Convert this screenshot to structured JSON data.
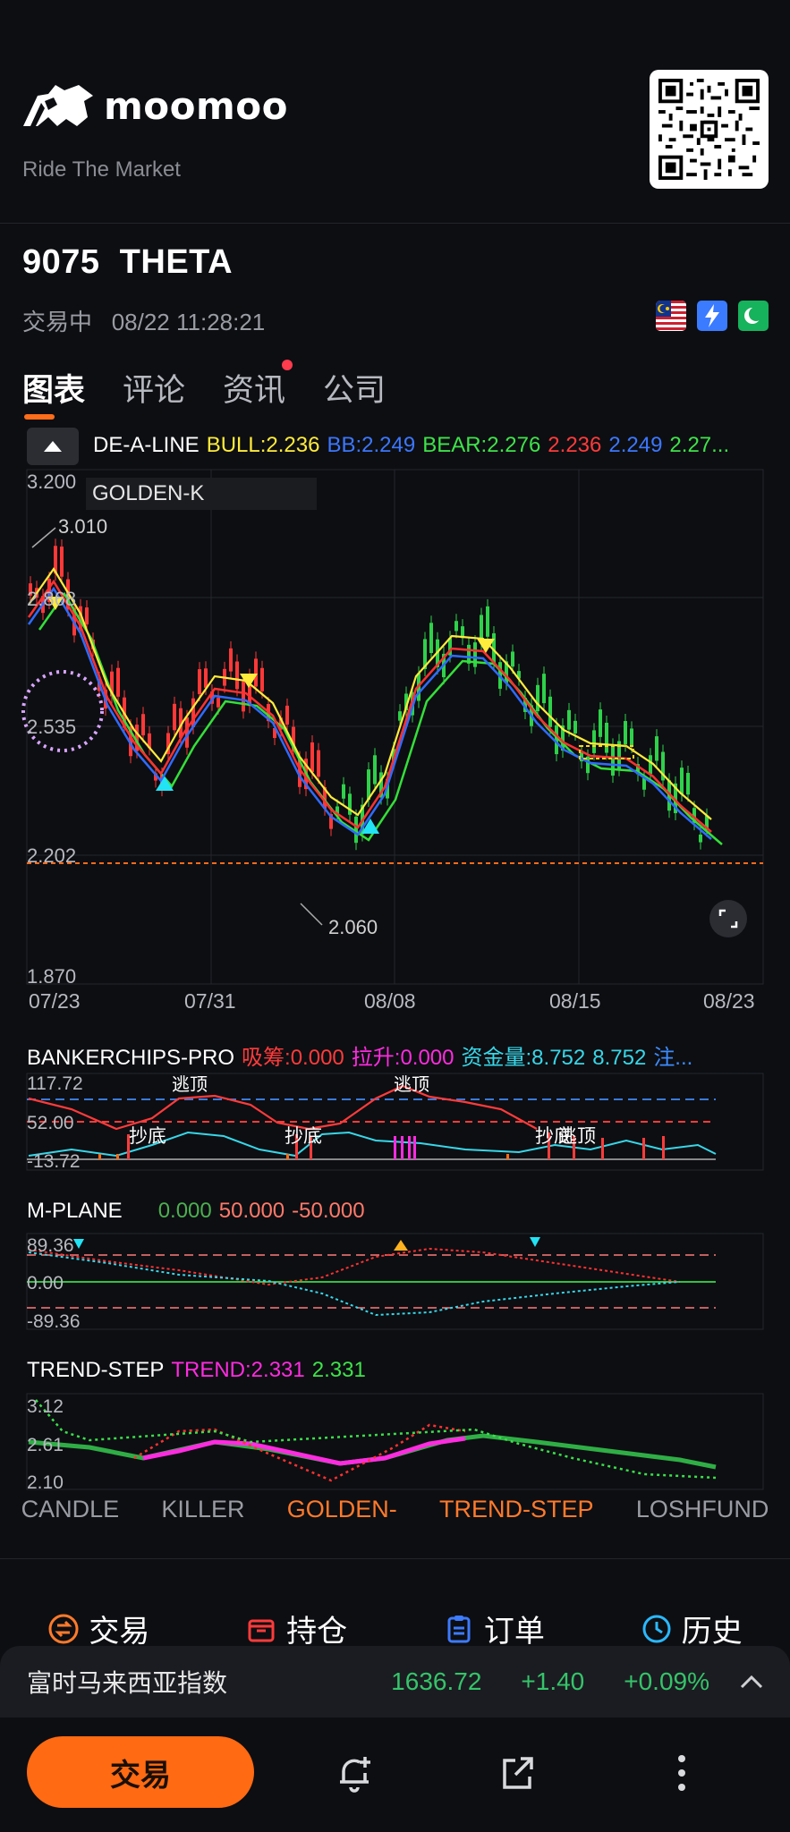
{
  "brand": {
    "name": "moomoo",
    "tagline": "Ride The Market"
  },
  "stock": {
    "code": "9075",
    "name": "THETA",
    "status": "交易中",
    "datetime": "08/22 11:28:21"
  },
  "tabs": [
    "图表",
    "评论",
    "资讯",
    "公司"
  ],
  "main_indicator": {
    "name": "DE-A-LINE",
    "bull": "BULL:2.236",
    "bb": "BB:2.249",
    "bear": "BEAR:2.276",
    "v1": "2.236",
    "v2": "2.249",
    "v3": "2.27...",
    "overlay_label": "GOLDEN-K",
    "colors": {
      "bull": "#ffeb3b",
      "bb": "#2f6bff",
      "bear": "#34e03a",
      "red": "#ff3131"
    }
  },
  "price_axis": [
    "3.200",
    "2.868",
    "2.535",
    "2.202",
    "1.870"
  ],
  "price_notes": {
    "high": "3.010",
    "low": "2.060"
  },
  "date_axis": [
    "07/23",
    "07/31",
    "08/08",
    "08/15",
    "08/23"
  ],
  "bankerchips": {
    "name": "BANKERCHIPS-PRO",
    "xichou": "吸筹:0.000",
    "lasheng": "拉升:0.000",
    "zijin": "资金量:8.752",
    "zijin2": "8.752",
    "zhu": "注...",
    "axis": [
      "117.72",
      "52.00",
      "-13.72"
    ],
    "labels": [
      "逃顶",
      "抄底",
      "逃顶",
      "抄底",
      "逃顶",
      "抄底"
    ]
  },
  "mplane": {
    "name": "M-PLANE",
    "v1": "0.000",
    "v2": "50.000",
    "v3": "-50.000",
    "axis": [
      "89.36",
      "0.00",
      "-89.36"
    ]
  },
  "trend_step": {
    "name": "TREND-STEP",
    "trend": "TREND:2.331",
    "v": "2.331",
    "axis": [
      "3.12",
      "2.61",
      "2.10"
    ]
  },
  "indicator_tabs": [
    {
      "label": "CANDLE",
      "active": false
    },
    {
      "label": "KILLER",
      "active": false
    },
    {
      "label": "GOLDEN-",
      "active": true
    },
    {
      "label": "TREND-STEP",
      "active": true
    },
    {
      "label": "LOSHFUND",
      "active": false
    }
  ],
  "actions": [
    {
      "label": "交易",
      "icon": "trade-icon",
      "color": "#ff7a2b"
    },
    {
      "label": "持仓",
      "icon": "position-icon",
      "color": "#ff3b3b"
    },
    {
      "label": "订单",
      "icon": "order-icon",
      "color": "#3d7bff"
    },
    {
      "label": "历史",
      "icon": "history-icon",
      "color": "#2bb8ff"
    }
  ],
  "index_bar": {
    "name": "富时马来西亚指数",
    "value": "1636.72",
    "change": "+1.40",
    "pct": "+0.09%"
  },
  "bottom": {
    "trade": "交易"
  }
}
